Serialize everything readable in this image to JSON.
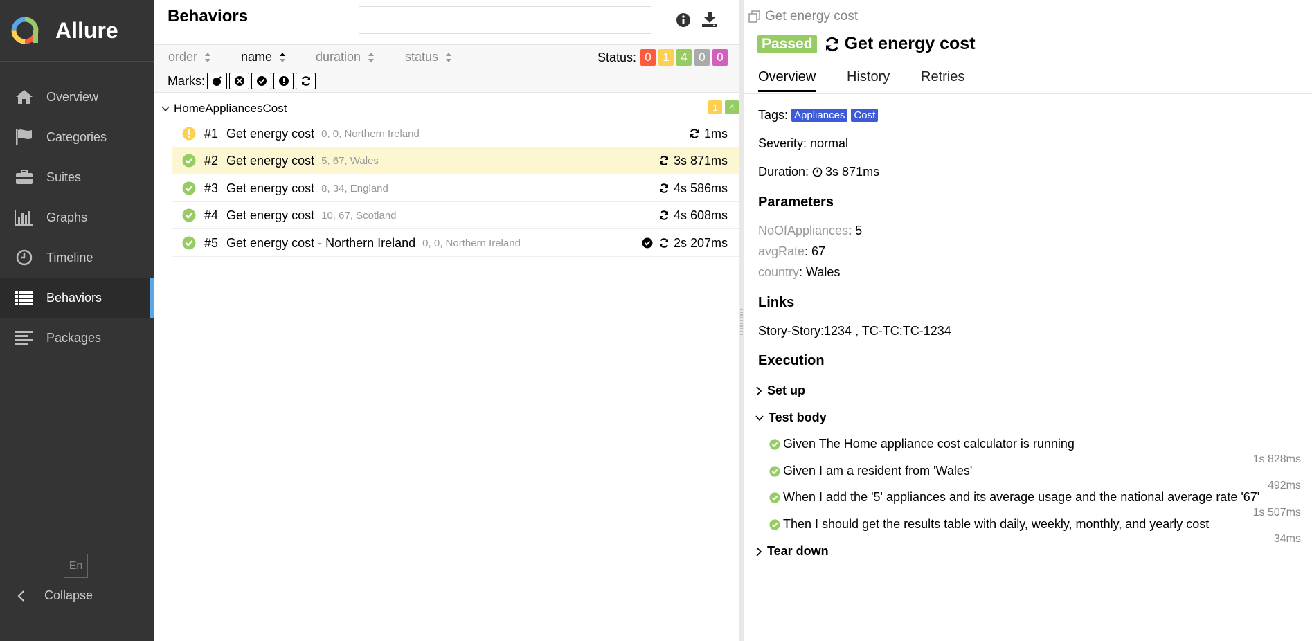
{
  "app": {
    "name": "Allure"
  },
  "sidebar": {
    "items": [
      {
        "label": "Overview",
        "icon": "home-icon"
      },
      {
        "label": "Categories",
        "icon": "flag-icon"
      },
      {
        "label": "Suites",
        "icon": "briefcase-icon"
      },
      {
        "label": "Graphs",
        "icon": "bar-chart-icon"
      },
      {
        "label": "Timeline",
        "icon": "clock-icon"
      },
      {
        "label": "Behaviors",
        "icon": "list-icon",
        "active": true
      },
      {
        "label": "Packages",
        "icon": "align-left-icon"
      }
    ],
    "language": "En",
    "collapse_label": "Collapse"
  },
  "behaviors": {
    "title": "Behaviors",
    "search_value": "",
    "sort": {
      "order": "order",
      "name": "name",
      "duration": "duration",
      "status": "status"
    },
    "status_label": "Status:",
    "status_counts": [
      "0",
      "1",
      "4",
      "0",
      "0"
    ],
    "marks_label": "Marks:",
    "group": {
      "name": "HomeAppliancesCost",
      "counts": [
        "1",
        "4"
      ]
    },
    "rows": [
      {
        "num": "#1",
        "name": "Get energy cost",
        "params": "0, 0, Northern Ireland",
        "duration": "1ms",
        "status": "broken"
      },
      {
        "num": "#2",
        "name": "Get energy cost",
        "params": "5, 67, Wales",
        "duration": "3s 871ms",
        "status": "passed"
      },
      {
        "num": "#3",
        "name": "Get energy cost",
        "params": "8, 34, England",
        "duration": "4s 586ms",
        "status": "passed"
      },
      {
        "num": "#4",
        "name": "Get energy cost",
        "params": "10, 67, Scotland",
        "duration": "4s 608ms",
        "status": "passed"
      },
      {
        "num": "#5",
        "name": "Get energy cost - Northern Ireland",
        "params": "0, 0, Northern Ireland",
        "duration": "2s 207ms",
        "status": "passed"
      }
    ]
  },
  "detail": {
    "breadcrumb": "Get energy cost",
    "status_badge": "Passed",
    "title": "Get energy cost",
    "tabs": [
      "Overview",
      "History",
      "Retries"
    ],
    "tags_label": "Tags:",
    "tags": [
      "Appliances",
      "Cost"
    ],
    "severity": "Severity: normal",
    "duration_label": "Duration:",
    "duration_value": "3s 871ms",
    "parameters_title": "Parameters",
    "parameters": [
      {
        "key": "NoOfAppliances",
        "value": ": 5"
      },
      {
        "key": "avgRate",
        "value": ": 67"
      },
      {
        "key": "country",
        "value": ": Wales"
      }
    ],
    "links_title": "Links",
    "links": "Story-Story:1234 , TC-TC:TC-1234",
    "execution_title": "Execution",
    "setup_label": "Set up",
    "body_label": "Test body",
    "steps": [
      {
        "text": "Given The Home appliance cost calculator is running",
        "time": "1s 828ms"
      },
      {
        "text": "Given I am a resident from 'Wales'",
        "time": "492ms"
      },
      {
        "text": "When I add the '5' appliances and its average usage and the national average rate '67'",
        "time": "1s 507ms"
      },
      {
        "text": "Then I should get the results table with daily, weekly, monthly, and yearly cost",
        "time": "34ms"
      }
    ],
    "teardown_label": "Tear down"
  },
  "colors": {
    "failed": "#fd5a3e",
    "broken": "#ffd050",
    "passed": "#97cc64",
    "skipped": "#aaaaaa",
    "unknown": "#d35ebe",
    "tag": "#3d5bd6",
    "sidebar_bg": "#343434",
    "active_bar": "#5aa6e9",
    "selected_row": "#fcf6d1"
  }
}
